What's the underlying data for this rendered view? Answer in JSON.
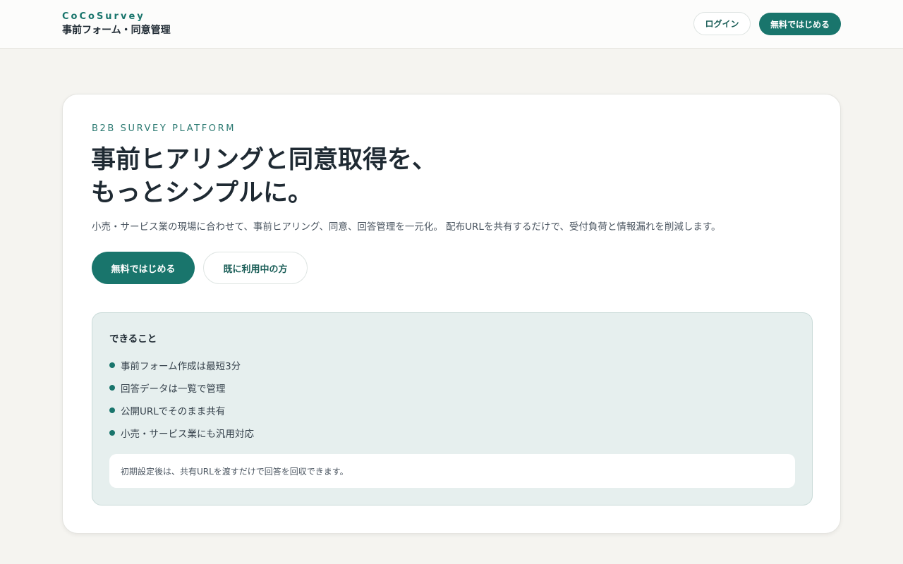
{
  "header": {
    "brand_name": "CoCoSurvey",
    "brand_subtitle": "事前フォーム・同意管理",
    "login_label": "ログイン",
    "start_label": "無料ではじめる"
  },
  "hero": {
    "eyebrow": "B2B SURVEY PLATFORM",
    "headline_line1": "事前ヒアリングと同意取得を、",
    "headline_line2": "もっとシンプルに。",
    "lead": "小売・サービス業の現場に合わせて、事前ヒアリング、同意、回答管理を一元化。 配布URLを共有するだけで、受付負荷と情報漏れを削減します。",
    "primary_button": "無料ではじめる",
    "secondary_button": "既に利用中の方"
  },
  "features": {
    "title": "できること",
    "items": [
      "事前フォーム作成は最短3分",
      "回答データは一覧で管理",
      "公開URLでそのまま共有",
      "小売・サービス業にも汎用対応"
    ],
    "note": "初期設定後は、共有URLを渡すだけで回答を回収できます。"
  },
  "colors": {
    "accent": "#19756c",
    "background": "#f5f4f0",
    "panel": "#e6efee"
  }
}
